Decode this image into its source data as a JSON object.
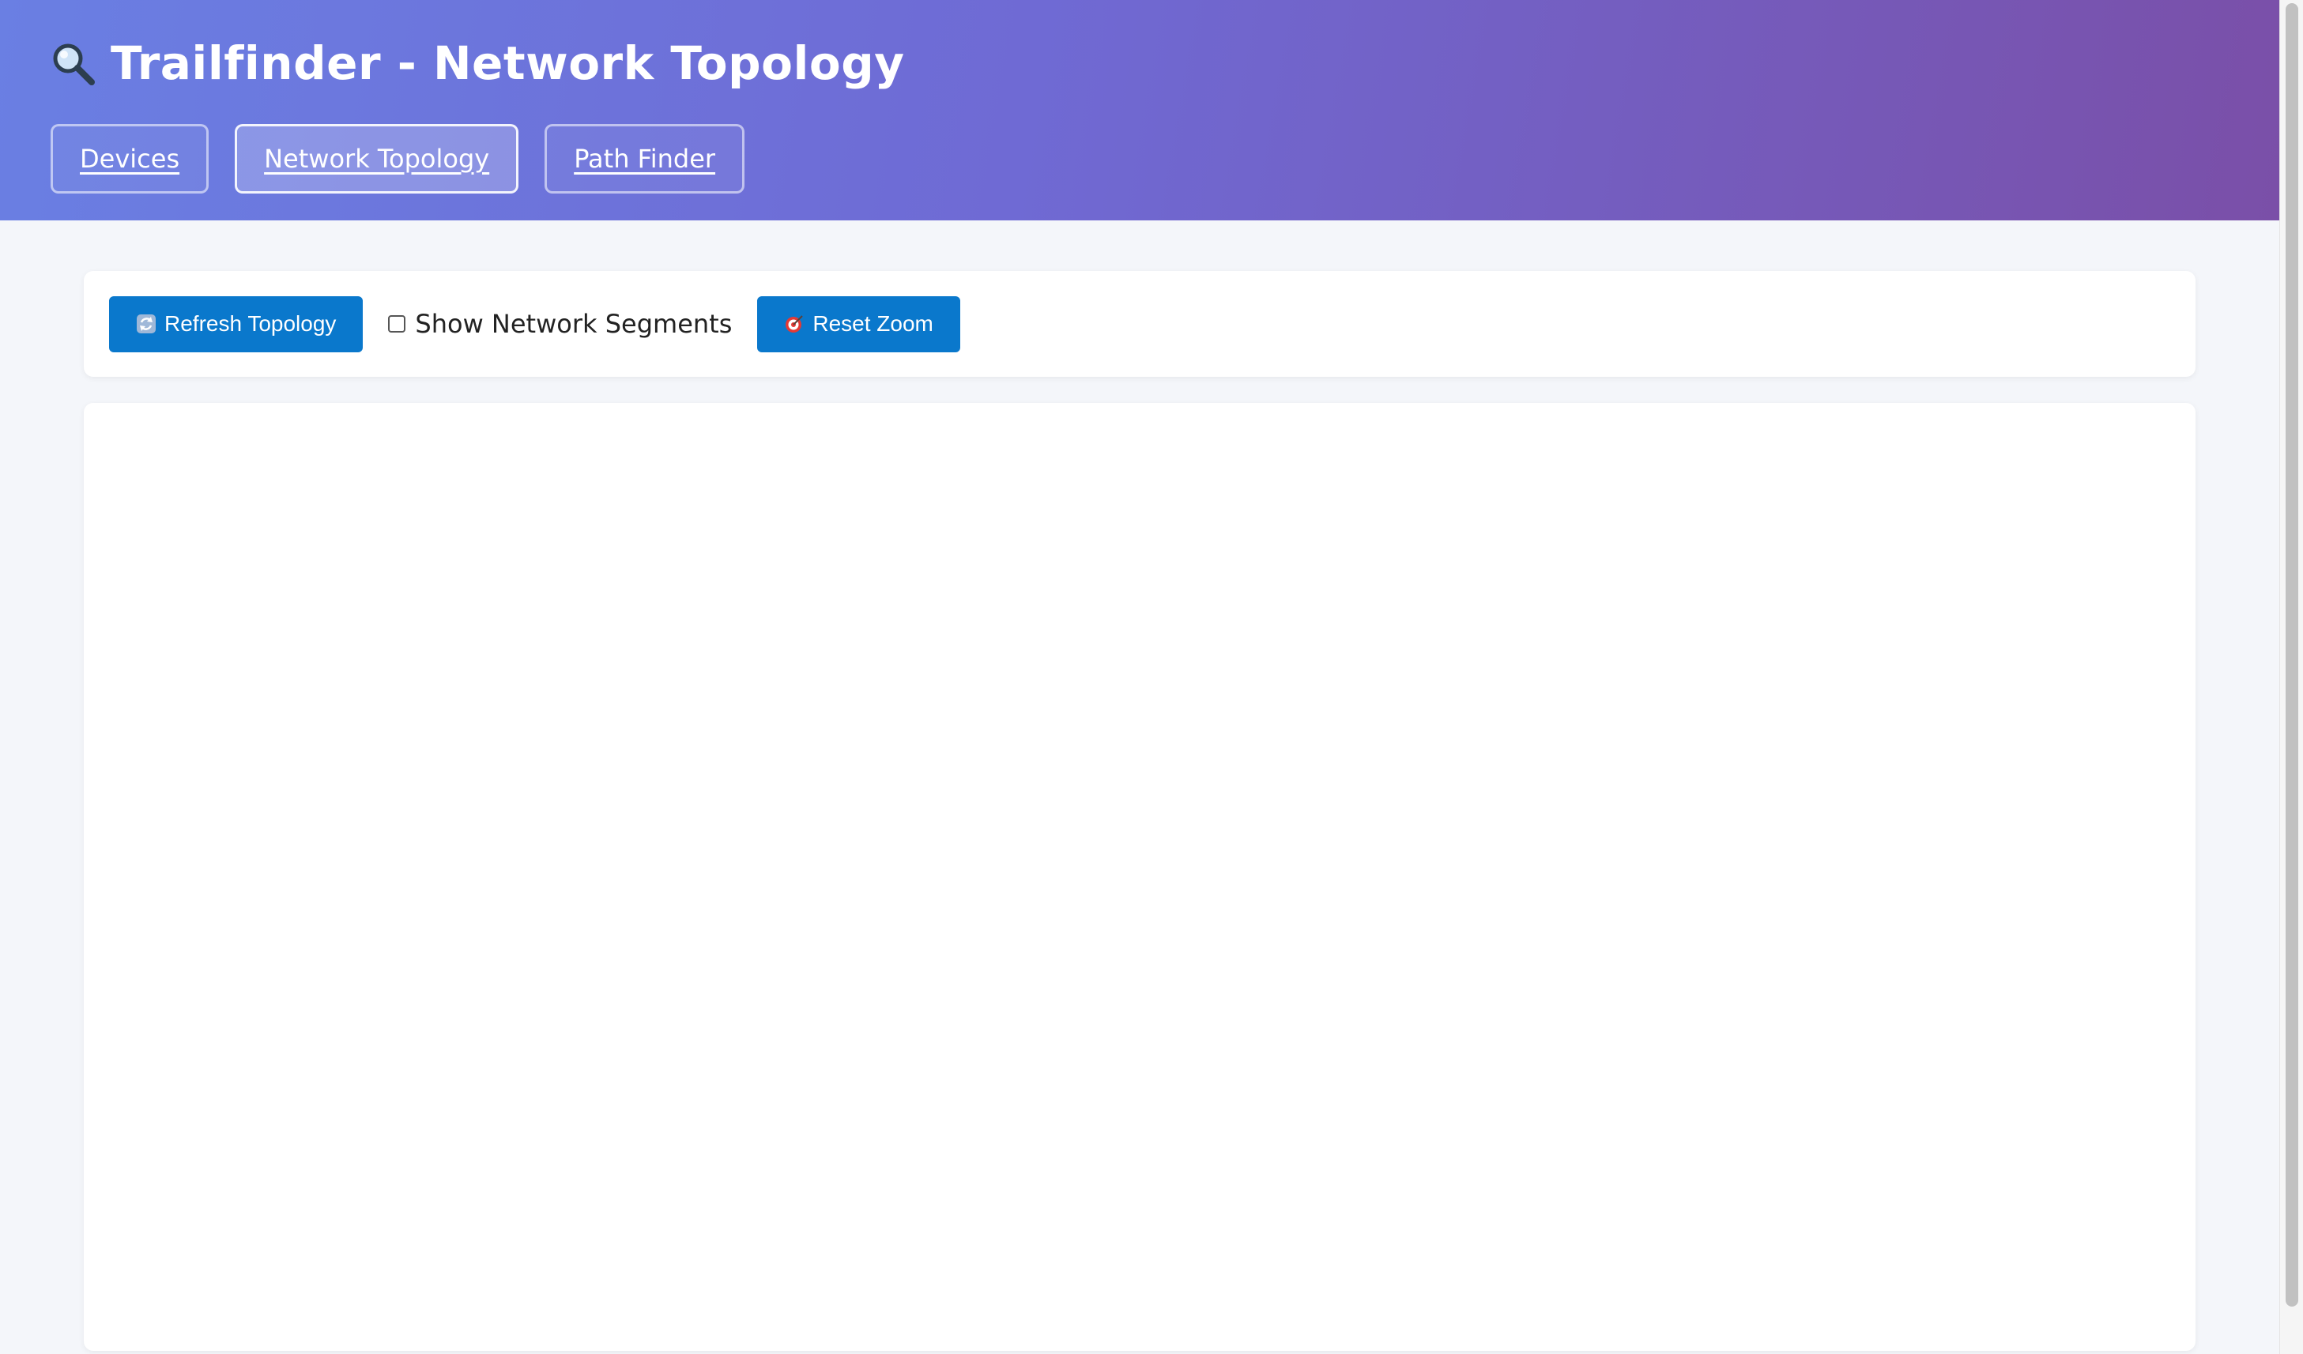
{
  "header": {
    "title": "Trailfinder - Network Topology",
    "title_icon": "magnifier-icon",
    "gradient_colors": [
      "#6a7fe3",
      "#7a4fa8"
    ]
  },
  "nav": {
    "tabs": [
      {
        "label": "Devices",
        "active": false
      },
      {
        "label": "Network Topology",
        "active": true
      },
      {
        "label": "Path Finder",
        "active": false
      }
    ]
  },
  "toolbar": {
    "refresh_label": "Refresh Topology",
    "refresh_icon": "refresh-icon",
    "segments_label": "Show Network Segments",
    "segments_checked": false,
    "reset_zoom_label": "Reset Zoom",
    "reset_zoom_icon": "target-icon",
    "button_color": "#0a78cc"
  }
}
